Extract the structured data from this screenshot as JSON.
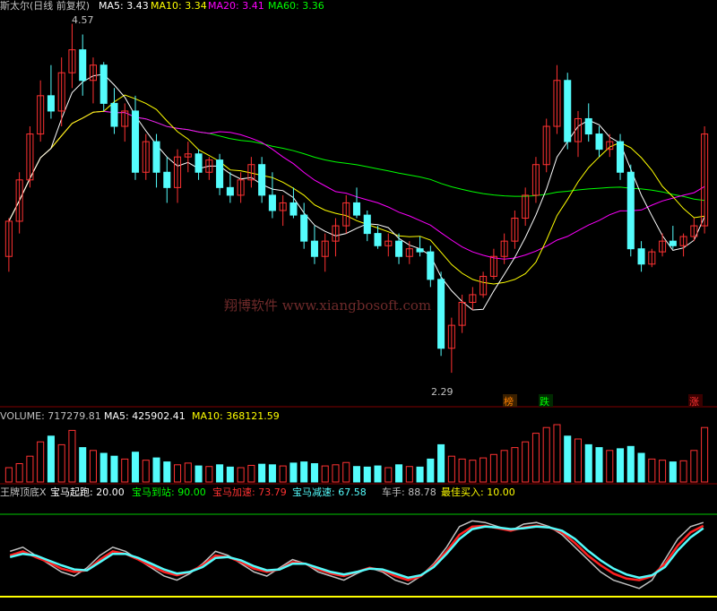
{
  "header": {
    "title": "斯太尔(日线 前复权)",
    "ma5": "MA5: 3.43",
    "ma10": "MA10: 3.34",
    "ma20": "MA20: 3.41",
    "ma60": "MA60: 3.36"
  },
  "volume_header": {
    "volume": "VOLUME: 717279.81",
    "ma5": "MA5: 425902.41",
    "ma10": "MA10: 368121.59"
  },
  "indicator_header": {
    "name": "王牌顶底X",
    "start": "宝马起跑: 20.00",
    "arrive": "宝马到站: 90.00",
    "accel": "宝马加速: 73.79",
    "decel": "宝马减速: 67.58",
    "driver": "车手: 88.78",
    "buy": "最佳买入: 10.00"
  },
  "watermark": "翔博软件 www.xiangbosoft.com",
  "annotations": {
    "high": "4.57",
    "low": "2.29"
  },
  "tags": [
    "榜",
    "跌",
    "涨"
  ],
  "colors": {
    "up": "#ff3232",
    "down": "#54fcfc",
    "ma5": "#ffffff",
    "ma10": "#ffff00",
    "ma20": "#ff00ff",
    "ma60": "#00ff00"
  },
  "chart_data": {
    "type": "candlestick",
    "ylim": [
      2.15,
      4.62
    ],
    "candles": [
      [
        3.05,
        3.3,
        2.95,
        3.28
      ],
      [
        3.28,
        3.6,
        3.2,
        3.55
      ],
      [
        3.55,
        3.9,
        3.5,
        3.85
      ],
      [
        3.85,
        4.2,
        3.8,
        4.1
      ],
      [
        4.1,
        4.3,
        3.95,
        4.0
      ],
      [
        4.0,
        4.35,
        3.9,
        4.25
      ],
      [
        4.25,
        4.57,
        4.15,
        4.4
      ],
      [
        4.4,
        4.5,
        4.1,
        4.2
      ],
      [
        4.2,
        4.35,
        4.05,
        4.3
      ],
      [
        4.3,
        4.32,
        4.0,
        4.05
      ],
      [
        4.05,
        4.15,
        3.85,
        3.9
      ],
      [
        3.9,
        4.05,
        3.8,
        4.0
      ],
      [
        4.0,
        4.1,
        3.55,
        3.6
      ],
      [
        3.6,
        3.85,
        3.55,
        3.8
      ],
      [
        3.8,
        3.85,
        3.5,
        3.6
      ],
      [
        3.6,
        3.7,
        3.4,
        3.5
      ],
      [
        3.5,
        3.75,
        3.4,
        3.7
      ],
      [
        3.7,
        3.8,
        3.6,
        3.72
      ],
      [
        3.72,
        3.75,
        3.55,
        3.6
      ],
      [
        3.6,
        3.7,
        3.55,
        3.68
      ],
      [
        3.68,
        3.72,
        3.45,
        3.5
      ],
      [
        3.5,
        3.6,
        3.4,
        3.45
      ],
      [
        3.45,
        3.6,
        3.4,
        3.55
      ],
      [
        3.55,
        3.7,
        3.5,
        3.65
      ],
      [
        3.65,
        3.7,
        3.4,
        3.45
      ],
      [
        3.45,
        3.6,
        3.3,
        3.35
      ],
      [
        3.35,
        3.45,
        3.25,
        3.4
      ],
      [
        3.4,
        3.5,
        3.3,
        3.32
      ],
      [
        3.32,
        3.4,
        3.1,
        3.15
      ],
      [
        3.15,
        3.25,
        3.0,
        3.05
      ],
      [
        3.05,
        3.2,
        2.95,
        3.15
      ],
      [
        3.15,
        3.3,
        3.05,
        3.25
      ],
      [
        3.25,
        3.45,
        3.2,
        3.4
      ],
      [
        3.4,
        3.5,
        3.3,
        3.32
      ],
      [
        3.32,
        3.35,
        3.15,
        3.2
      ],
      [
        3.2,
        3.25,
        3.1,
        3.12
      ],
      [
        3.12,
        3.2,
        3.05,
        3.15
      ],
      [
        3.15,
        3.2,
        3.0,
        3.05
      ],
      [
        3.05,
        3.15,
        3.0,
        3.1
      ],
      [
        3.1,
        3.18,
        3.05,
        3.08
      ],
      [
        3.08,
        3.12,
        2.85,
        2.9
      ],
      [
        2.9,
        2.95,
        2.4,
        2.45
      ],
      [
        2.45,
        2.65,
        2.29,
        2.6
      ],
      [
        2.6,
        2.8,
        2.55,
        2.75
      ],
      [
        2.75,
        2.85,
        2.7,
        2.8
      ],
      [
        2.8,
        2.95,
        2.78,
        2.92
      ],
      [
        2.92,
        3.1,
        2.9,
        3.05
      ],
      [
        3.05,
        3.2,
        3.0,
        3.15
      ],
      [
        3.15,
        3.35,
        3.1,
        3.3
      ],
      [
        3.3,
        3.5,
        3.25,
        3.45
      ],
      [
        3.45,
        3.7,
        3.4,
        3.65
      ],
      [
        3.65,
        3.95,
        3.6,
        3.9
      ],
      [
        3.9,
        4.3,
        3.85,
        4.2
      ],
      [
        4.2,
        4.25,
        3.75,
        3.8
      ],
      [
        3.8,
        4.0,
        3.7,
        3.95
      ],
      [
        3.95,
        4.05,
        3.8,
        3.85
      ],
      [
        3.85,
        3.9,
        3.7,
        3.75
      ],
      [
        3.75,
        3.85,
        3.7,
        3.8
      ],
      [
        3.8,
        3.85,
        3.55,
        3.6
      ],
      [
        3.6,
        3.65,
        3.05,
        3.1
      ],
      [
        3.1,
        3.15,
        2.95,
        3.0
      ],
      [
        3.0,
        3.1,
        2.98,
        3.08
      ],
      [
        3.08,
        3.2,
        3.05,
        3.15
      ],
      [
        3.15,
        3.25,
        3.1,
        3.12
      ],
      [
        3.12,
        3.2,
        3.05,
        3.18
      ],
      [
        3.18,
        3.3,
        3.15,
        3.25
      ],
      [
        3.25,
        3.9,
        3.2,
        3.85
      ]
    ],
    "volume": [
      0.25,
      0.32,
      0.45,
      0.7,
      0.8,
      0.65,
      0.9,
      0.6,
      0.55,
      0.5,
      0.45,
      0.4,
      0.52,
      0.38,
      0.42,
      0.35,
      0.3,
      0.33,
      0.28,
      0.27,
      0.3,
      0.26,
      0.25,
      0.29,
      0.31,
      0.3,
      0.28,
      0.33,
      0.35,
      0.32,
      0.28,
      0.3,
      0.34,
      0.27,
      0.26,
      0.28,
      0.25,
      0.3,
      0.27,
      0.26,
      0.4,
      0.65,
      0.45,
      0.4,
      0.38,
      0.42,
      0.48,
      0.55,
      0.6,
      0.7,
      0.85,
      0.95,
      1.0,
      0.8,
      0.75,
      0.65,
      0.6,
      0.55,
      0.58,
      0.62,
      0.5,
      0.4,
      0.38,
      0.35,
      0.37,
      0.55,
      0.95
    ],
    "indicator": {
      "ylim": [
        0,
        100
      ],
      "white": [
        55,
        60,
        50,
        40,
        30,
        25,
        35,
        50,
        60,
        55,
        45,
        35,
        25,
        20,
        28,
        40,
        55,
        50,
        40,
        30,
        25,
        35,
        45,
        40,
        30,
        25,
        20,
        28,
        35,
        30,
        20,
        15,
        25,
        40,
        60,
        85,
        92,
        90,
        85,
        80,
        88,
        90,
        85,
        75,
        60,
        45,
        30,
        20,
        15,
        10,
        20,
        45,
        70,
        85,
        90
      ],
      "red": [
        50,
        55,
        48,
        42,
        34,
        30,
        32,
        45,
        55,
        52,
        45,
        37,
        30,
        26,
        30,
        38,
        50,
        48,
        42,
        34,
        30,
        33,
        42,
        40,
        33,
        28,
        25,
        30,
        35,
        32,
        25,
        20,
        25,
        38,
        55,
        75,
        85,
        86,
        83,
        80,
        84,
        86,
        84,
        78,
        65,
        50,
        38,
        28,
        22,
        20,
        25,
        40,
        62,
        78,
        86
      ],
      "cyan": [
        48,
        52,
        50,
        44,
        38,
        33,
        32,
        42,
        52,
        52,
        47,
        40,
        33,
        28,
        30,
        36,
        47,
        48,
        44,
        37,
        32,
        33,
        40,
        40,
        35,
        30,
        27,
        30,
        34,
        33,
        28,
        23,
        26,
        36,
        52,
        70,
        82,
        85,
        84,
        82,
        83,
        85,
        84,
        80,
        70,
        56,
        44,
        34,
        27,
        23,
        26,
        36,
        56,
        72,
        83
      ]
    }
  }
}
